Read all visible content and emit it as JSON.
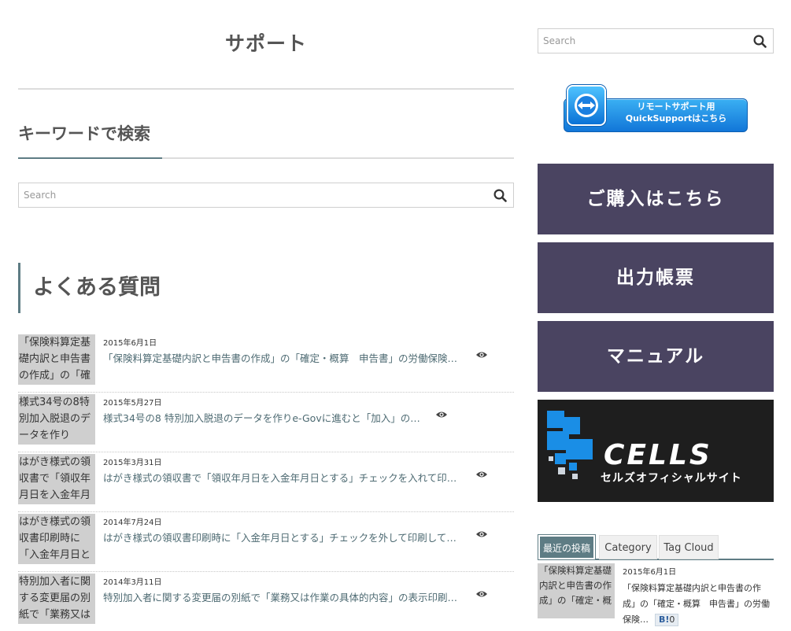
{
  "page": {
    "title": "サポート",
    "keyword_section_title": "キーワードで検索",
    "faq_title": "よくある質問"
  },
  "search": {
    "placeholder": "Search",
    "icon": "magnifier"
  },
  "posts": [
    {
      "thumb_text": "「保険料算定基礎内訳と申告書の作成」の「確定・",
      "date": "2015年6月1日",
      "title": "「保険料算定基礎内訳と申告書の作成」の「確定・概算　申告書」の労働保険…",
      "icon": "eye"
    },
    {
      "thumb_text": "様式34号の8特別加入脱退のデータを作り",
      "date": "2015年5月27日",
      "title": "様式34号の8 特別加入脱退のデータを作りe-Govに進むと「加入」の…",
      "icon": "eye"
    },
    {
      "thumb_text": "はがき様式の領収書で「領収年月日を入金年月日",
      "date": "2015年3月31日",
      "title": "はがき様式の領収書で「領収年月日を入金年月日とする」チェックを入れて印…",
      "icon": "eye"
    },
    {
      "thumb_text": "はがき様式の領収書印刷時に「入金年月日と",
      "date": "2014年7月24日",
      "title": "はがき様式の領収書印刷時に「入金年月日とする」チェックを外して印刷して…",
      "icon": "eye"
    },
    {
      "thumb_text": "特別加入者に関する変更届の別紙で「業務又は",
      "date": "2014年3月11日",
      "title": "特別加入者に関する変更届の別紙で「業務又は作業の具体的内容」の表示印刷…",
      "icon": "eye"
    }
  ],
  "sidebar": {
    "quicksupport_banner": {
      "line1": "リモートサポート用",
      "line2": "QuickSupportはこちら"
    },
    "nav_blocks": [
      {
        "label": "ご購入はこちら"
      },
      {
        "label": "出力帳票"
      },
      {
        "label": "マニュアル"
      }
    ],
    "cells_banner": {
      "word": "CELLS",
      "subtitle": "セルズオフィシャルサイト"
    },
    "tabs": [
      {
        "label": "最近の投稿",
        "active": true
      },
      {
        "label": "Category",
        "active": false
      },
      {
        "label": "Tag Cloud",
        "active": false
      }
    ],
    "recent_post": {
      "thumb_text": "「保険料算定基礎内訳と申告書の作成」の「確定・概",
      "date": "2015年6月1日",
      "title": "「保険料算定基礎内訳と申告書の作成」の「確定・概算　申告書」の労働保険…",
      "hatena_label": "B!",
      "hatena_count": "0"
    }
  },
  "colors": {
    "accent": "#5e7c84",
    "nav_block": "#4a4461",
    "link": "#4d6a72",
    "cells_bg": "#1e1e1e",
    "cells_blue": "#1a8ee6"
  }
}
